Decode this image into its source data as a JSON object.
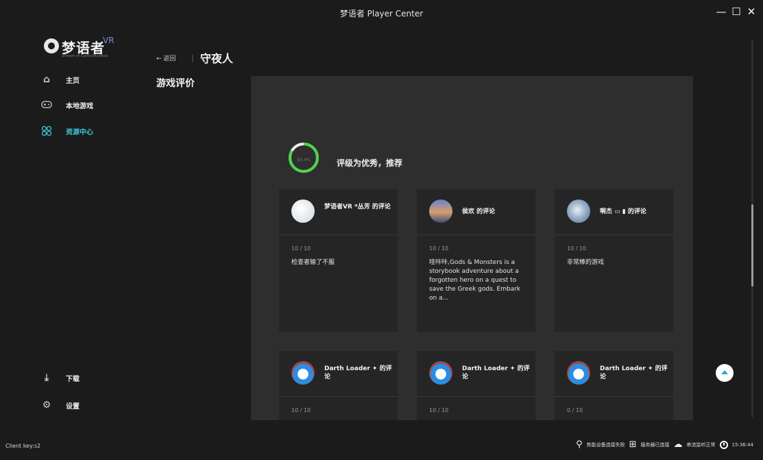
{
  "window": {
    "title": "梦语者 Player Center",
    "controls": [
      "—",
      "☐",
      "✕"
    ]
  },
  "logo": {
    "name": "梦语者",
    "vr": "VR",
    "subtitle": "Stream of Consciousness"
  },
  "sidebar": {
    "items": [
      {
        "label": "主页",
        "icon": "home-icon"
      },
      {
        "label": "本地游戏",
        "icon": "gamepad-icon"
      },
      {
        "label": "资源中心",
        "icon": "resource-center-icon",
        "active": true
      }
    ],
    "bottom_items": [
      {
        "label": "下载",
        "icon": "download-icon"
      },
      {
        "label": "设置",
        "icon": "gear-icon"
      }
    ]
  },
  "header": {
    "back_label": "← 返回",
    "separator": "|",
    "game_title": "守夜人"
  },
  "section_title": "游戏评价",
  "rating": {
    "percent_label": "83.4%",
    "percent": 83.4,
    "label": "评级为优秀，推荐",
    "accent": "#4cd34c"
  },
  "reviews": [
    {
      "author": "梦语者VR *丛芳 的评论",
      "score": "10 / 10",
      "text": "检查者输了不服"
    },
    {
      "author": "侯欢 的评论",
      "score": "10 / 10",
      "text": "哇咔咔,Gods & Monsters is a storybook adventure about a forgotten hero on a quest to save the Greek gods. Embark on a..."
    },
    {
      "author": "啊杰 ▭ ▮ 的评论",
      "score": "10 / 10",
      "text": "非常棒的游戏"
    },
    {
      "author": "Darth Loader ✦ 的评论",
      "score": "10 / 10",
      "text": ""
    },
    {
      "author": "Darth Loader ✦ 的评论",
      "score": "10 / 10",
      "text": ""
    },
    {
      "author": "Darth Loader ✦ 的评论",
      "score": "0 / 10",
      "text": ""
    }
  ],
  "status_bar": {
    "client_key": "Client key:s2",
    "device_status": "势能设备连接失败",
    "server_status": "服务器已连接",
    "stream_status": "串流监听正常",
    "time": "15:36:44"
  }
}
